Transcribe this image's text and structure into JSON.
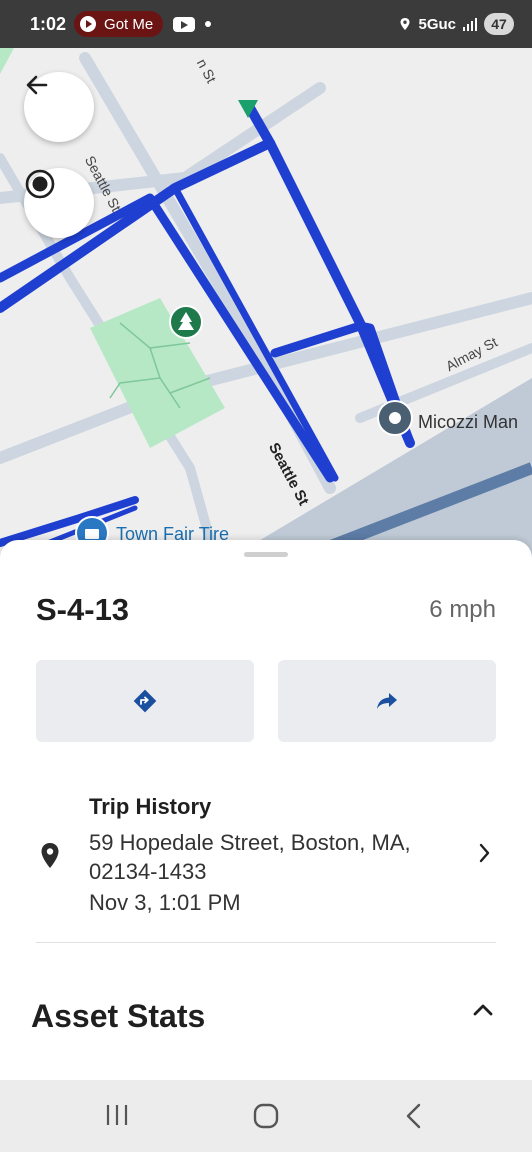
{
  "status_bar": {
    "time": "1:02",
    "media_chip": "Got Me",
    "network": "5Guc",
    "battery": "47"
  },
  "map": {
    "labels": {
      "street_top": "n St",
      "seattle_upper": "Seattle St",
      "seattle_lower": "Seattle St",
      "almay": "Almay St",
      "micozzi": "Micozzi Man",
      "town_fair": "Town Fair Tire"
    },
    "colors": {
      "route": "#1f3fd1",
      "park": "#b6e8c5",
      "road": "#c9d4e0",
      "background": "#eeeeee"
    }
  },
  "asset": {
    "name": "S-4-13",
    "speed": "6 mph"
  },
  "actions": {
    "directions_icon": "directions-icon",
    "share_icon": "share-arrow-icon"
  },
  "trip": {
    "title": "Trip History",
    "address": "59 Hopedale Street, Boston, MA, 02134-1433",
    "time": "Nov 3, 1:01 PM"
  },
  "stats": {
    "title": "Asset Stats"
  },
  "accent_color": "#1b4fa0"
}
